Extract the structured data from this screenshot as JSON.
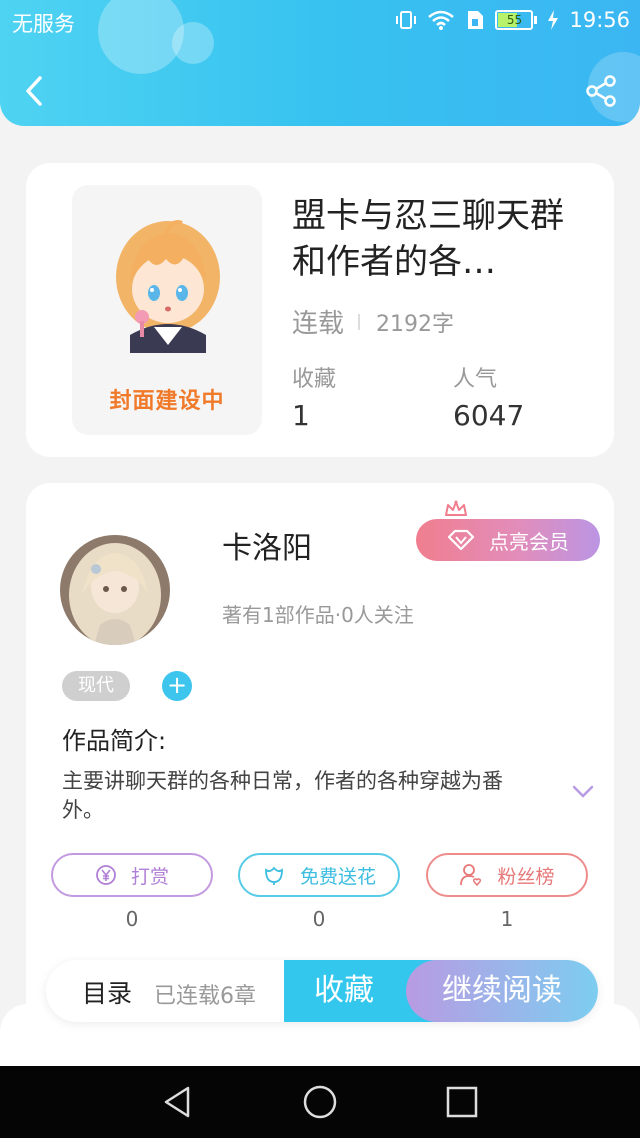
{
  "status_bar": {
    "carrier": "无服务",
    "battery": "55",
    "time": "19:56"
  },
  "book": {
    "title": "盟卡与忍三聊天群和作者的各…",
    "serial_status": "连载",
    "word_count": "2192字",
    "favorites_label": "收藏",
    "favorites_value": "1",
    "popularity_label": "人气",
    "popularity_value": "6047",
    "cover_text": "封面建设中"
  },
  "author": {
    "name": "卡洛阳",
    "meta": "著有1部作品·0人关注",
    "vip_label": "点亮会员"
  },
  "tags": [
    "现代"
  ],
  "intro": {
    "title": "作品简介:",
    "text": "主要讲聊天群的各种日常，作者的各种穿越为番外。"
  },
  "actions": [
    {
      "label": "打赏",
      "count": "0",
      "icon": "yen-icon"
    },
    {
      "label": "免费送花",
      "count": "0",
      "icon": "flower-icon"
    },
    {
      "label": "粉丝榜",
      "count": "1",
      "icon": "fan-icon"
    }
  ],
  "bottom": {
    "toc": "目录",
    "toc_sub": "已连载6章",
    "favorite": "收藏",
    "continue_read": "继续阅读"
  },
  "colors": {
    "header": "#37c2f0",
    "accent_blue": "#33c7ee",
    "vip_pink": "#f07e8f",
    "purple": "#b89be2"
  }
}
